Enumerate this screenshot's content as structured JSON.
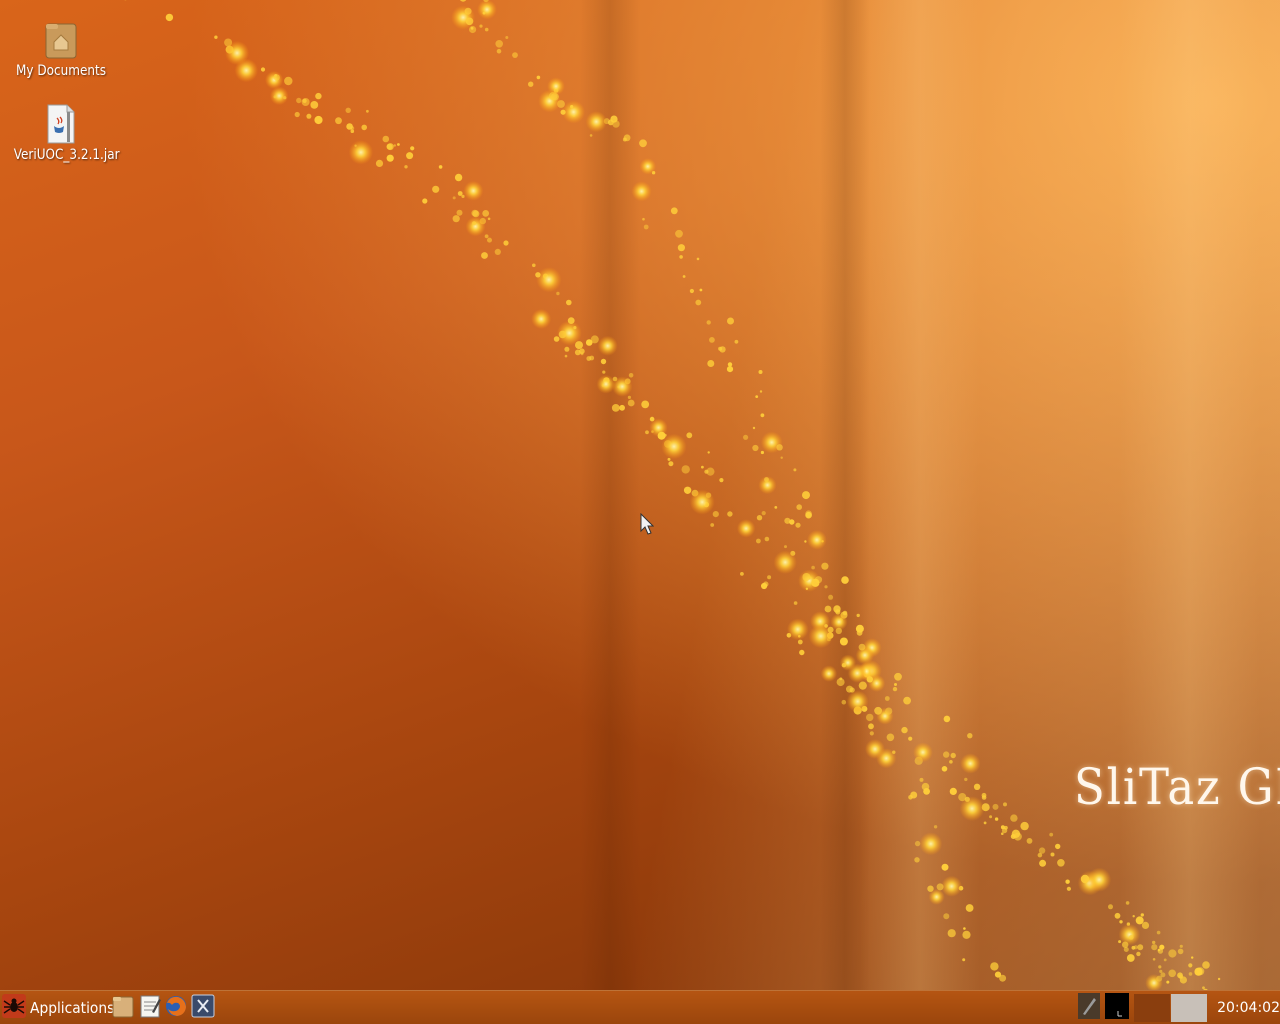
{
  "desktop": {
    "icons": [
      {
        "label": "My Documents",
        "icon": "home-folder-icon"
      },
      {
        "label": "VeriUOC_3.2.1.jar",
        "icon": "java-jar-icon"
      }
    ],
    "brand_text": "SliTaz GN"
  },
  "taskbar": {
    "applications_label": "Applications",
    "launchers": [
      "file-manager-icon",
      "text-editor-icon",
      "firefox-icon",
      "terminal-icon"
    ],
    "tray": [
      "pen-tool-icon",
      "terminal-monitor-icon",
      "workspace-1",
      "workspace-2"
    ],
    "clock": "20:04:02"
  },
  "colors": {
    "wallpaper_primary": "#c8571a",
    "wallpaper_dark": "#7a3108",
    "sparkle": "#ffd23a",
    "taskbar": "#a84c0f"
  }
}
